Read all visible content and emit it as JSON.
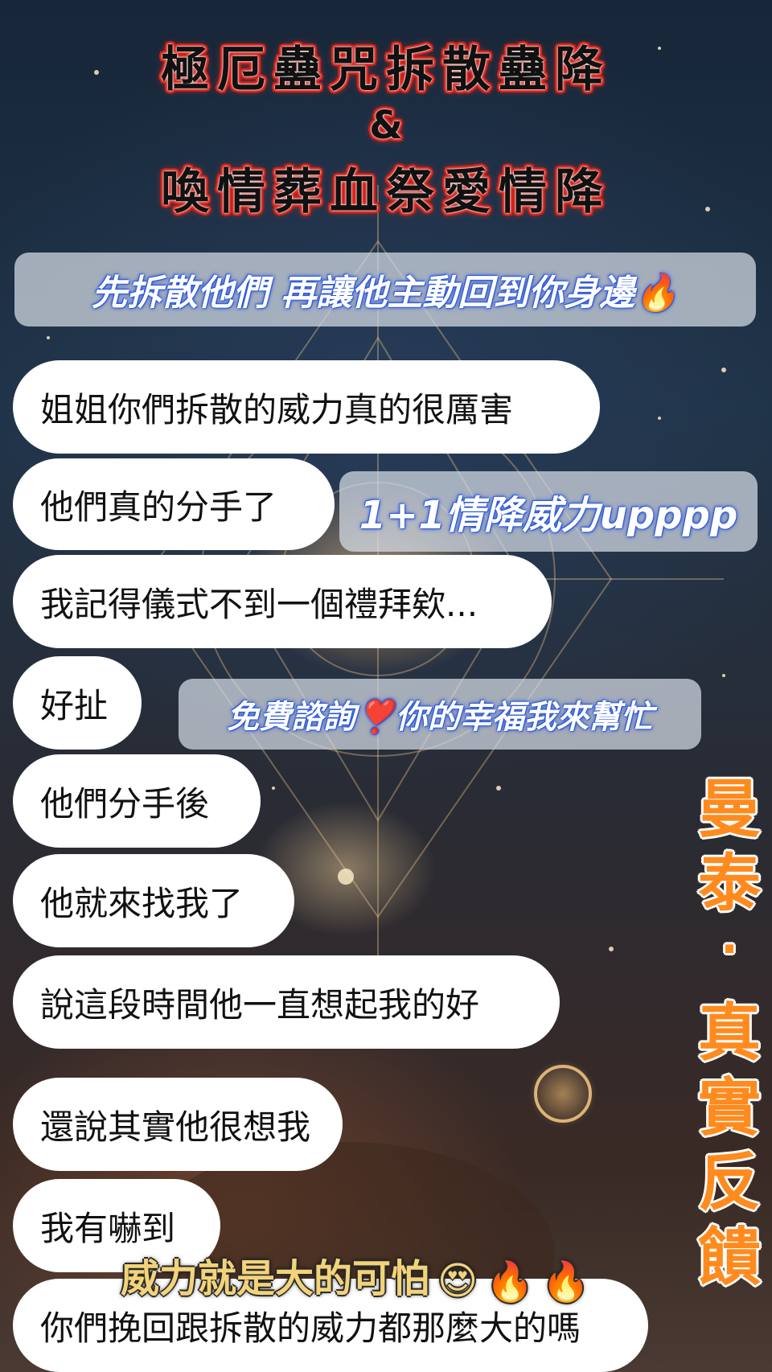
{
  "title": {
    "line1": "極厄蠱咒拆散蠱降",
    "amp": "&",
    "line2": "喚情葬血祭愛情降"
  },
  "banners": {
    "top": "先拆散他們 再讓他主動回到你身邊🔥",
    "power_up": "1+1情降威力upppp",
    "free": "免費諮詢❣️你的幸福我來幫忙"
  },
  "messages": [
    "姐姐你們拆散的威力真的很厲害",
    "他們真的分手了",
    "我記得儀式不到一個禮拜欸...",
    "好扯",
    "他們分手後",
    "他就來找我了",
    "說這段時間他一直想起我的好",
    "還說其實他很想我",
    "我有嚇到",
    "你們挽回跟拆散的威力都那麼大的嗎"
  ],
  "side_title": [
    "曼",
    "泰",
    "·",
    "真",
    "實",
    "反",
    "饋"
  ],
  "overlay": {
    "power_text": "威力就是大的可怕",
    "emoji_face": "😍",
    "emoji_fire1": "🔥",
    "emoji_fire2": "🔥"
  },
  "colors": {
    "title_outline": "#d21a12",
    "banner_glow": "#2a55d8",
    "side_title": "#ff8a1e",
    "overlay_text": "#f3d37a"
  }
}
